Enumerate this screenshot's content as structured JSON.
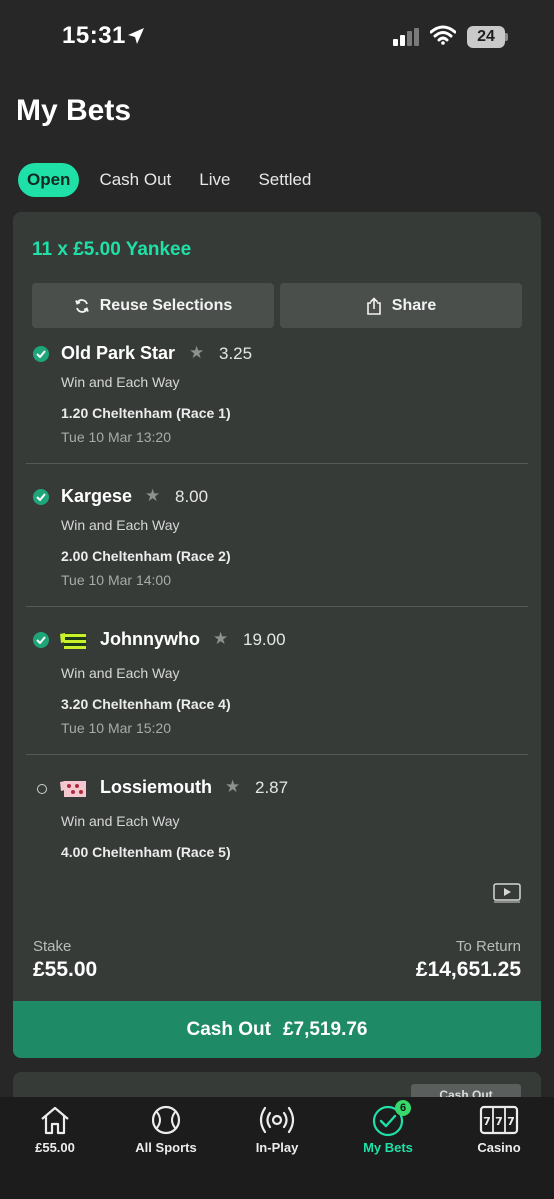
{
  "status_bar": {
    "time": "15:31",
    "battery": "24"
  },
  "page": {
    "title": "My Bets"
  },
  "tabs": [
    {
      "label": "Open",
      "active": true
    },
    {
      "label": "Cash Out",
      "active": false
    },
    {
      "label": "Live",
      "active": false
    },
    {
      "label": "Settled",
      "active": false
    }
  ],
  "bet": {
    "title": "11 x £5.00 Yankee",
    "reuse_label": "Reuse Selections",
    "share_label": "Share",
    "selections": [
      {
        "name": "Old Park Star",
        "odds": "3.25",
        "type": "Win and Each Way",
        "race": "1.20 Cheltenham (Race 1)",
        "time": "Tue 10 Mar 13:20",
        "status": "won"
      },
      {
        "name": "Kargese",
        "odds": "8.00",
        "type": "Win and Each Way",
        "race": "2.00 Cheltenham (Race 2)",
        "time": "Tue 10 Mar 14:00",
        "status": "won"
      },
      {
        "name": "Johnnywho",
        "odds": "19.00",
        "type": "Win and Each Way",
        "race": "3.20 Cheltenham (Race 4)",
        "time": "Tue 10 Mar 15:20",
        "status": "won"
      },
      {
        "name": "Lossiemouth",
        "odds": "2.87",
        "type": "Win and Each Way",
        "race": "4.00 Cheltenham (Race 5)",
        "time": "",
        "status": "open"
      }
    ],
    "stake_label": "Stake",
    "stake_value": "£55.00",
    "return_label": "To Return",
    "return_value": "£14,651.25",
    "cashout_label": "Cash Out",
    "cashout_value": "£7,519.76"
  },
  "next_card": {
    "tag": "Cash Out"
  },
  "bottom_nav": [
    {
      "label": "£55.00",
      "icon": "home-icon"
    },
    {
      "label": "All Sports",
      "icon": "ball-icon"
    },
    {
      "label": "In-Play",
      "icon": "broadcast-icon"
    },
    {
      "label": "My Bets",
      "icon": "check-circle-icon",
      "badge": "6",
      "active": true
    },
    {
      "label": "Casino",
      "icon": "slot-machine-icon"
    }
  ],
  "colors": {
    "accent": "#1fe0a6",
    "cashout": "#1e8a66",
    "background": "#262726",
    "card": "#363b38"
  }
}
